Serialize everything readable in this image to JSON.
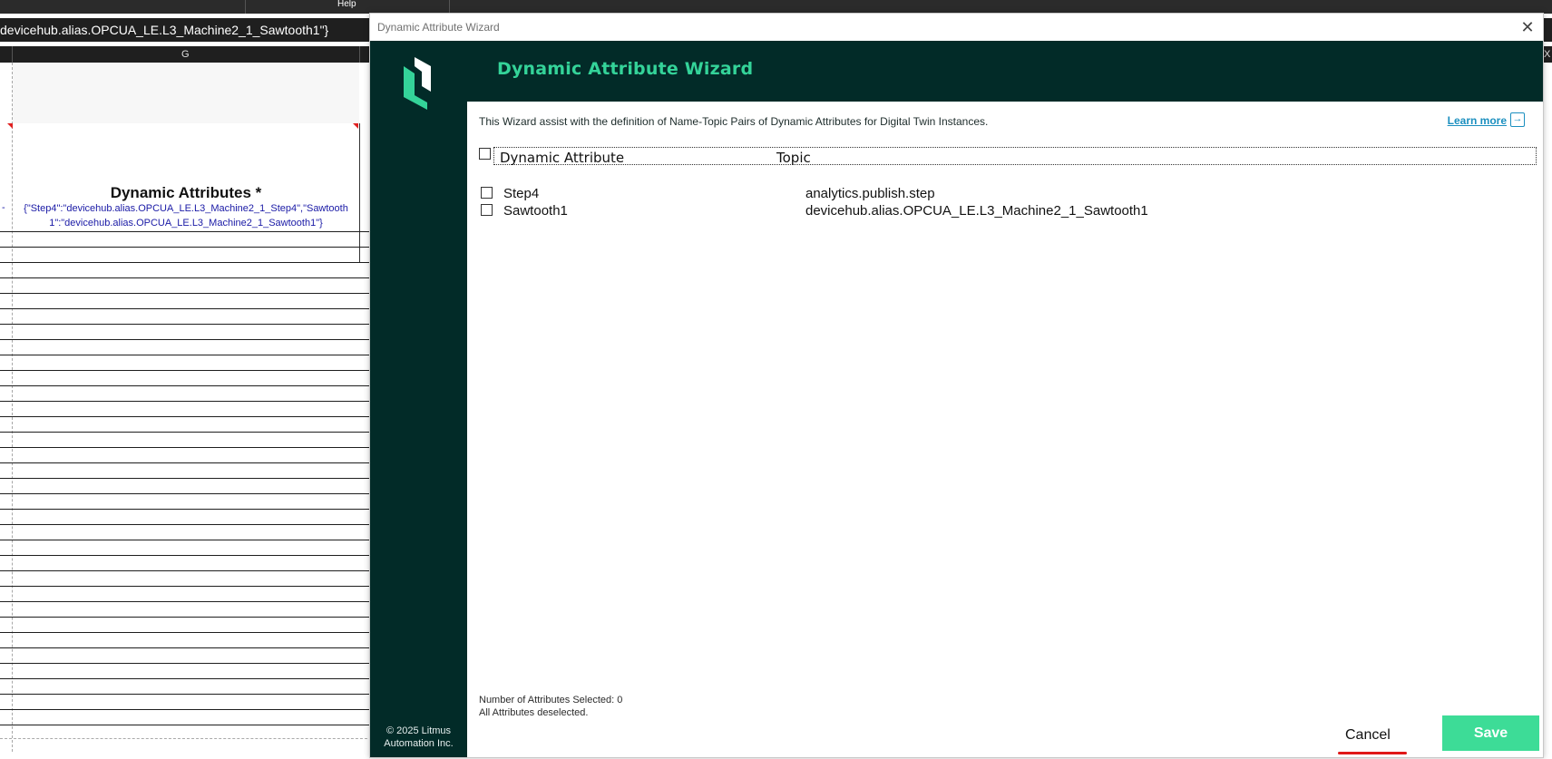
{
  "ribbon": {
    "help_label": "Help"
  },
  "formula_bar": {
    "text": "devicehub.alias.OPCUA_LE.L3_Machine2_1_Sawtooth1\"}"
  },
  "columns": {
    "g": "G",
    "x": "X"
  },
  "sheet": {
    "header": "Dynamic Attributes *",
    "value_line1": "{\"Step4\":\"devicehub.alias.OPCUA_LE.L3_Machine2_1_Step4\",\"Sawtooth",
    "value_line2": "1\":\"devicehub.alias.OPCUA_LE.L3_Machine2_1_Sawtooth1\"}",
    "row_marker": "-"
  },
  "dialog": {
    "window_title": "Dynamic Attribute Wizard",
    "close_glyph": "✕",
    "header_title": "Dynamic Attribute Wizard",
    "intro": "This Wizard assist with the definition of Name-Topic Pairs of Dynamic Attributes for Digital Twin Instances.",
    "learn_more": "Learn more",
    "learn_icon": "exit-arrow-icon",
    "table": {
      "col_name": "Dynamic Attribute",
      "col_topic": "Topic",
      "rows": [
        {
          "name": "Step4",
          "topic": "analytics.publish.step",
          "checked": false
        },
        {
          "name": "Sawtooth1",
          "topic": "devicehub.alias.OPCUA_LE.L3_Machine2_1_Sawtooth1",
          "checked": false
        }
      ]
    },
    "status_count": "Number of Attributes Selected: 0",
    "status_msg": "All Attributes deselected.",
    "cancel_label": "Cancel",
    "save_label": "Save",
    "copyright_line1": "© 2025 Litmus",
    "copyright_line2": "Automation Inc.",
    "colors": {
      "sidebar_bg": "#022b28",
      "accent_green": "#34d399",
      "save_bg": "#3ddc97",
      "link_blue": "#1b8fbf",
      "cancel_underline": "#e01818"
    }
  }
}
